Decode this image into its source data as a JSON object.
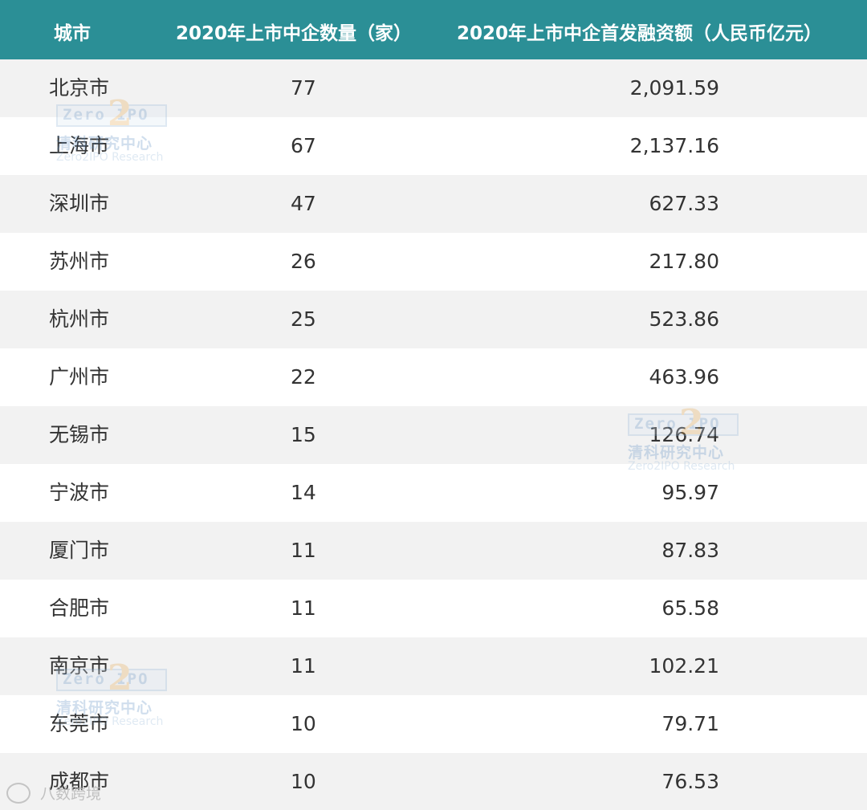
{
  "header": {
    "city": "城市",
    "count": "2020年上市中企数量（家）",
    "amount": "2020年上市中企首发融资额（人民币亿元）"
  },
  "rows": [
    {
      "city": "北京市",
      "count": "77",
      "amount": "2,091.59"
    },
    {
      "city": "上海市",
      "count": "67",
      "amount": "2,137.16"
    },
    {
      "city": "深圳市",
      "count": "47",
      "amount": "627.33"
    },
    {
      "city": "苏州市",
      "count": "26",
      "amount": "217.80"
    },
    {
      "city": "杭州市",
      "count": "25",
      "amount": "523.86"
    },
    {
      "city": "广州市",
      "count": "22",
      "amount": "463.96"
    },
    {
      "city": "无锡市",
      "count": "15",
      "amount": "126.74"
    },
    {
      "city": "宁波市",
      "count": "14",
      "amount": "95.97"
    },
    {
      "city": "厦门市",
      "count": "11",
      "amount": "87.83"
    },
    {
      "city": "合肥市",
      "count": "11",
      "amount": "65.58"
    },
    {
      "city": "南京市",
      "count": "11",
      "amount": "102.21"
    },
    {
      "city": "东莞市",
      "count": "10",
      "amount": "79.71"
    },
    {
      "city": "成都市",
      "count": "10",
      "amount": "76.53"
    }
  ],
  "watermark": {
    "logo": "Zero IPO",
    "logo_digit": "2",
    "cn": "清科研究中心",
    "en": "Zero2IPO Research"
  },
  "corner_watermark": "八数跨境",
  "colors": {
    "header_bg": "#2b8f96",
    "header_text": "#ffffff",
    "row_alt_bg": "#f2f2f2"
  }
}
